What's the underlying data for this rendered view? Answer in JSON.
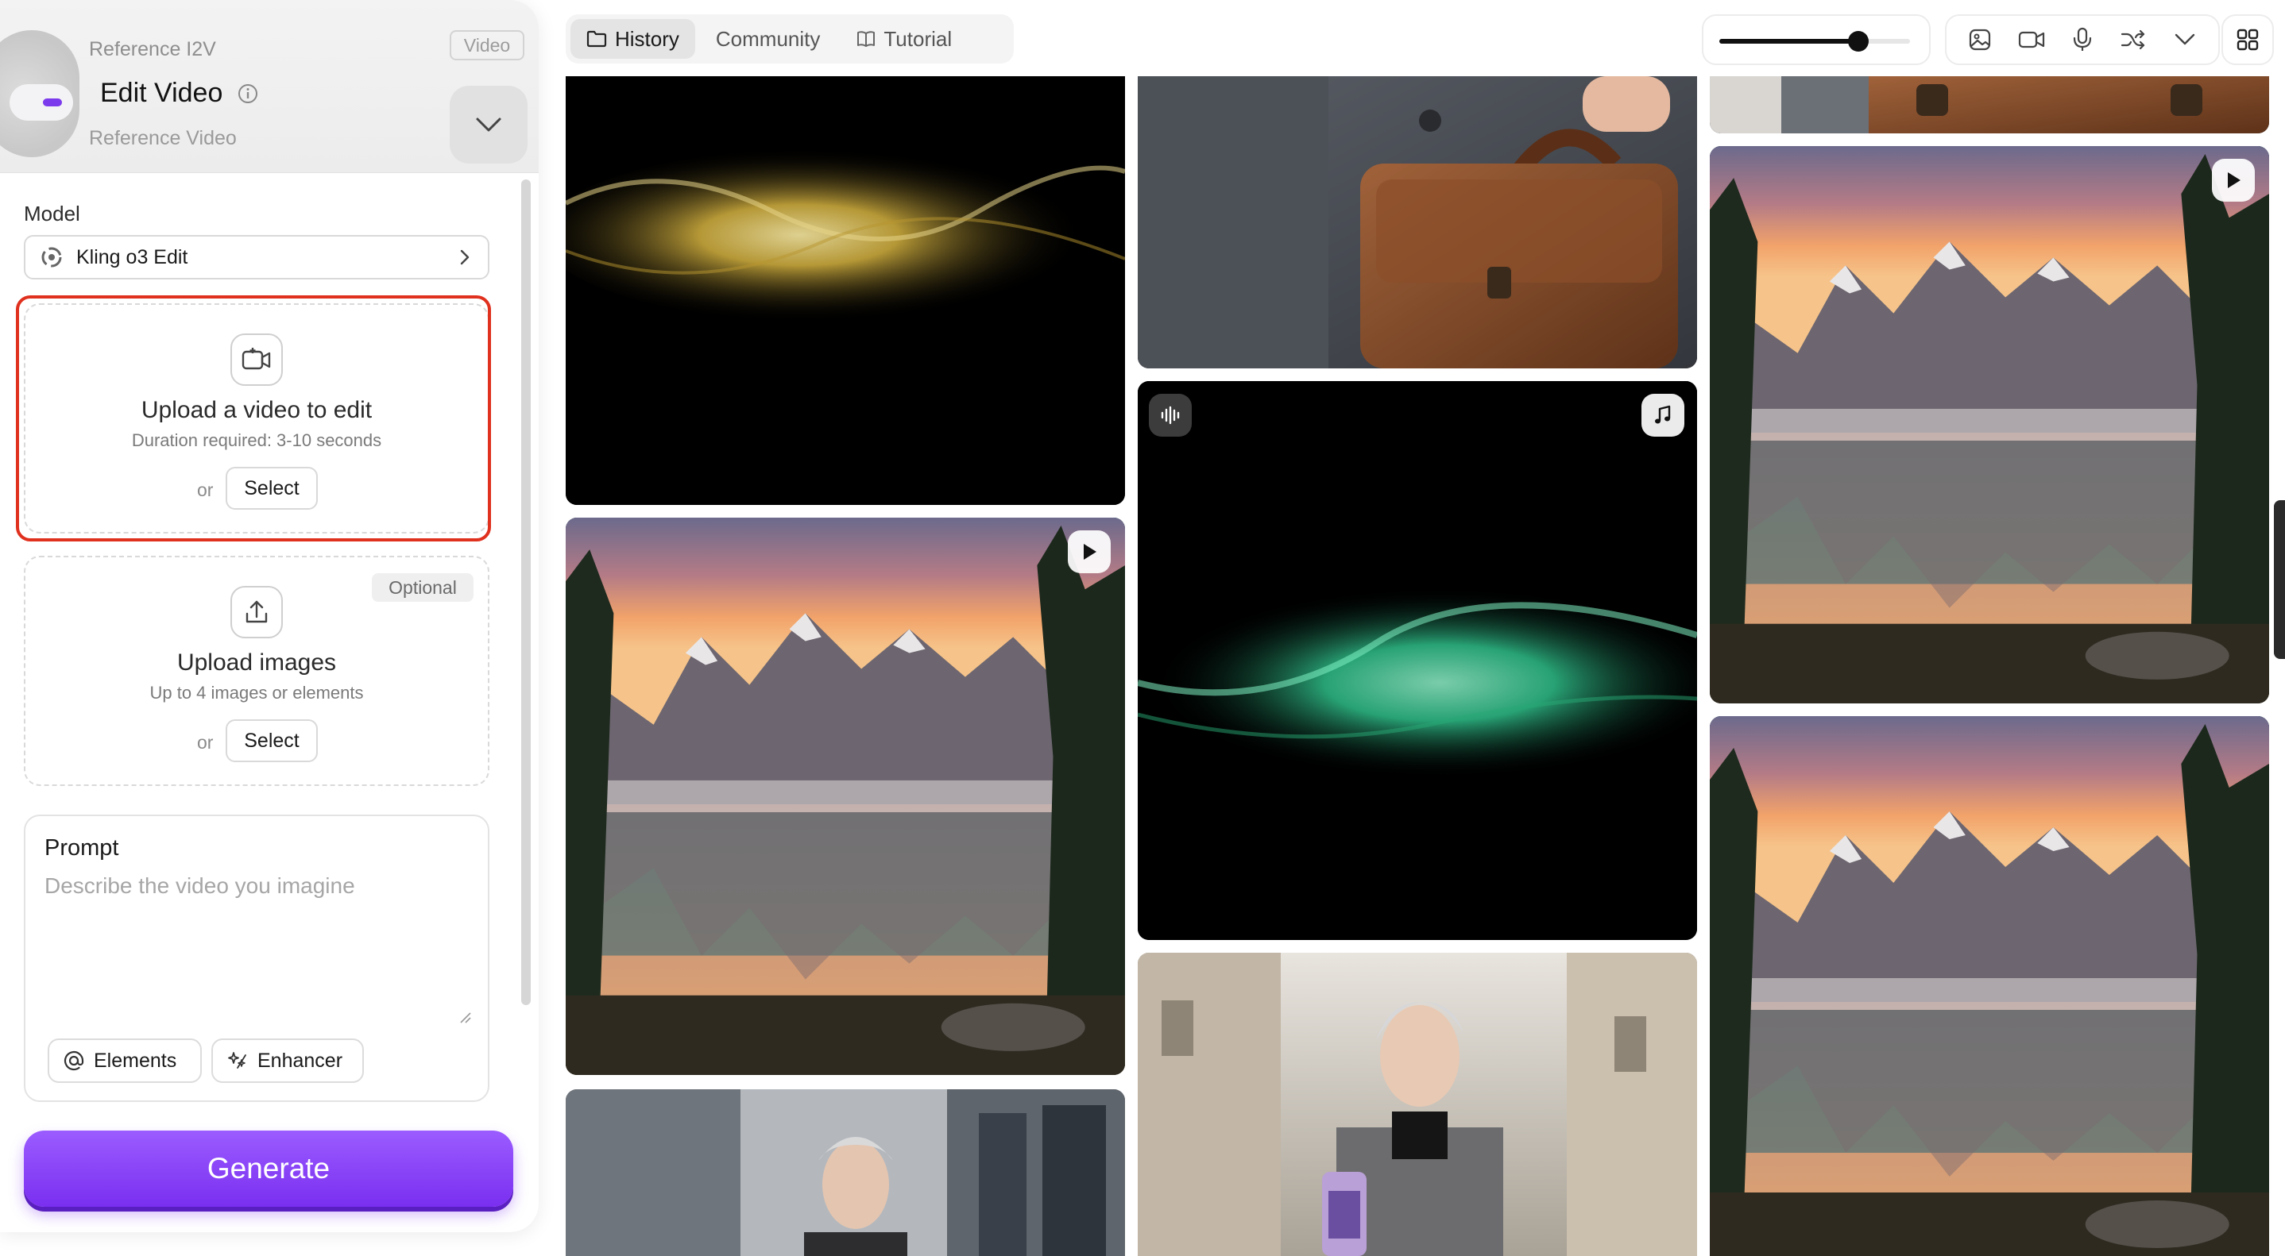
{
  "panel": {
    "header": {
      "mode_label": "Reference I2V",
      "title": "Edit Video",
      "subtitle": "Reference Video",
      "type_tag": "Video"
    },
    "model": {
      "label": "Model",
      "selected": "Kling o3 Edit"
    },
    "upload_video": {
      "title": "Upload a video to edit",
      "subtitle": "Duration required: 3-10 seconds",
      "or": "or",
      "select_label": "Select"
    },
    "upload_images": {
      "optional_tag": "Optional",
      "title": "Upload images",
      "subtitle": "Up to 4 images or elements",
      "or": "or",
      "select_label": "Select"
    },
    "prompt": {
      "label": "Prompt",
      "placeholder": "Describe the video you imagine",
      "elements_label": "Elements",
      "enhancer_label": "Enhancer"
    },
    "generate_label": "Generate"
  },
  "nav": {
    "tabs": [
      {
        "label": "History",
        "icon": "folder-icon",
        "active": true
      },
      {
        "label": "Community",
        "icon": "",
        "active": false
      },
      {
        "label": "Tutorial",
        "icon": "book-icon",
        "active": false
      }
    ],
    "size_slider": 0.73,
    "filter_icons": [
      "image-filter-icon",
      "video-filter-icon",
      "audio-filter-icon",
      "shuffle-icon",
      "chevron-down-icon"
    ],
    "layout_icon": "grid-icon"
  },
  "gallery": {
    "items": [
      {
        "kind": "golden-wave",
        "column": 1
      },
      {
        "kind": "mountain-lake",
        "column": 1,
        "overlay": "play-icon"
      },
      {
        "kind": "portrait-street",
        "column": 1
      },
      {
        "kind": "leather-bag",
        "column": 2
      },
      {
        "kind": "green-wave",
        "column": 2,
        "overlay_left": "audio-wave-icon",
        "overlay_right": "music-note-icon"
      },
      {
        "kind": "portrait-product",
        "column": 2
      },
      {
        "kind": "leather-bag-partial",
        "column": 3
      },
      {
        "kind": "mountain-lake",
        "column": 3,
        "overlay": "play-icon"
      },
      {
        "kind": "mountain-lake",
        "column": 3
      }
    ]
  },
  "colors": {
    "accent": "#7a2ff0",
    "highlight": "#e0301e"
  }
}
